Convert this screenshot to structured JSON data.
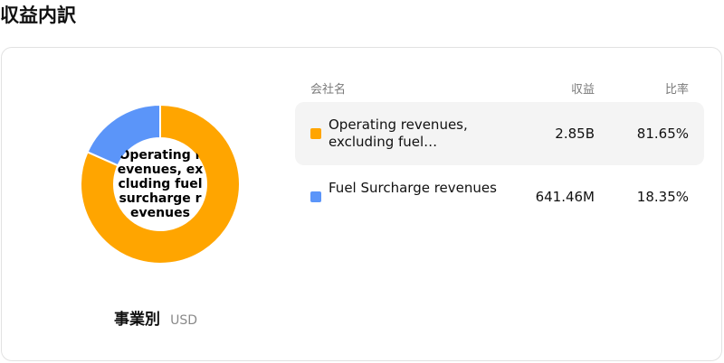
{
  "page": {
    "title": "収益内訳"
  },
  "breakdown": {
    "title": "事業別",
    "unit": "USD"
  },
  "table": {
    "headers": {
      "name": "会社名",
      "revenue": "収益",
      "ratio": "比率"
    },
    "rows": [
      {
        "name": "Operating revenues, excluding fuel…",
        "revenue": "2.85B",
        "ratio": "81.65%",
        "color": "#ffa500"
      },
      {
        "name": "Fuel Surcharge revenues",
        "revenue": "641.46M",
        "ratio": "18.35%",
        "color": "#5b95f9"
      }
    ]
  },
  "chart_data": {
    "type": "pie",
    "center_label": "Operating revenues, excluding fuel surcharge revenues",
    "categories": [
      "Operating revenues, excluding fuel surcharge revenues",
      "Fuel Surcharge revenues"
    ],
    "values": [
      81.65,
      18.35
    ],
    "colors": [
      "#ffa500",
      "#5b95f9"
    ]
  }
}
